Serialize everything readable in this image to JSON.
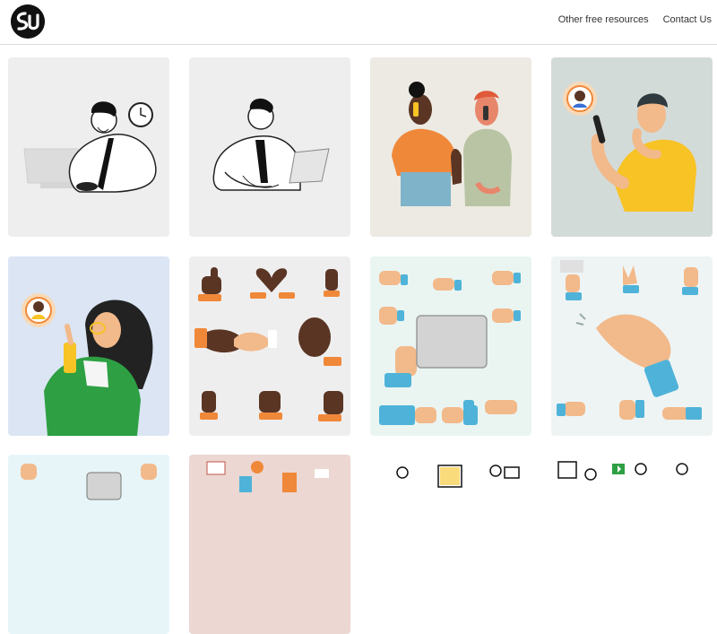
{
  "header": {
    "logo_label": "SU",
    "nav": [
      {
        "label": "Other free resources"
      },
      {
        "label": "Contact Us"
      }
    ]
  },
  "colors": {
    "accent_orange": "#f0883a",
    "accent_blue": "#4fb3d9",
    "accent_yellow": "#f7c325",
    "accent_green": "#2ea043",
    "skin_dark": "#5a3524",
    "skin_tan": "#f2b98a"
  },
  "gallery": [
    {
      "name": "man-at-desk-with-clock",
      "bg": "#eeeeee"
    },
    {
      "name": "man-with-laptop",
      "bg": "#eeeeee"
    },
    {
      "name": "two-people-on-phones",
      "bg": "#eceae2"
    },
    {
      "name": "man-on-phone-yellow-shirt",
      "bg": "#d3dbd8"
    },
    {
      "name": "woman-with-phone-call",
      "bg": "#dbe5f4"
    },
    {
      "name": "hand-gestures-dark-skin",
      "bg": "#eeeeee"
    },
    {
      "name": "hands-holding-card",
      "bg": "#eaf5f2"
    },
    {
      "name": "hands-clapping-light",
      "bg": "#eef4f4"
    },
    {
      "name": "hands-card-partial",
      "bg": "#e7f5f8"
    },
    {
      "name": "office-team-partial",
      "bg": "#ecd7d2"
    },
    {
      "name": "line-people-partial",
      "bg": "#ffffff"
    },
    {
      "name": "line-people-partial-2",
      "bg": "#ffffff"
    }
  ]
}
